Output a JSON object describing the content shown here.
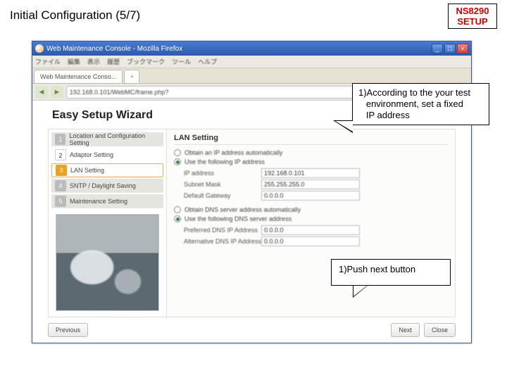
{
  "slide": {
    "title": "Initial Configuration  (5/7)",
    "badge_line1": "NS8290",
    "badge_line2": "SETUP"
  },
  "browser": {
    "window_title": "Web Maintenance Console - Mozilla Firefox",
    "menu": [
      "ファイル",
      "編集",
      "表示",
      "履歴",
      "ブックマーク",
      "ツール",
      "ヘルプ"
    ],
    "tab_label": "Web Maintenance Conso...",
    "tab_plus": "+",
    "nav_back": "◄",
    "nav_fwd": "►",
    "address": "192.168.0.101/WebMC/frame.php?",
    "win_min": "_",
    "win_max": "□",
    "win_close": "×"
  },
  "wizard": {
    "title": "Easy Setup Wizard",
    "steps": [
      {
        "num": "1",
        "label": "Location and Configuration Setting"
      },
      {
        "num": "2",
        "label": "Adaptor Setting"
      },
      {
        "num": "3",
        "label": "LAN Setting"
      },
      {
        "num": "4",
        "label": "SNTP / Daylight Saving"
      },
      {
        "num": "5",
        "label": "Maintenance Setting"
      }
    ],
    "pane_title": "LAN Setting",
    "radio_auto": "Obtain an IP address automatically",
    "radio_fixed": "Use the following IP address",
    "ip_label": "IP address",
    "ip_value": "192.168.0.101",
    "mask_label": "Subnet Mask",
    "mask_value": "255.255.255.0",
    "gw_label": "Default Gateway",
    "gw_value": "0.0.0.0",
    "radio_dns_auto": "Obtain DNS server address automatically",
    "radio_dns_fixed": "Use the following DNS server address",
    "dns1_label": "Preferred DNS IP Address",
    "dns1_value": "0.0.0.0",
    "dns2_label": "Alternative DNS IP Address",
    "dns2_value": "0.0.0.0",
    "btn_prev": "Previous",
    "btn_next": "Next",
    "btn_close": "Close"
  },
  "callouts": {
    "c1": "1)According to the your test\n   environment, set a fixed\n   IP address",
    "c2": "1)Push next button"
  }
}
